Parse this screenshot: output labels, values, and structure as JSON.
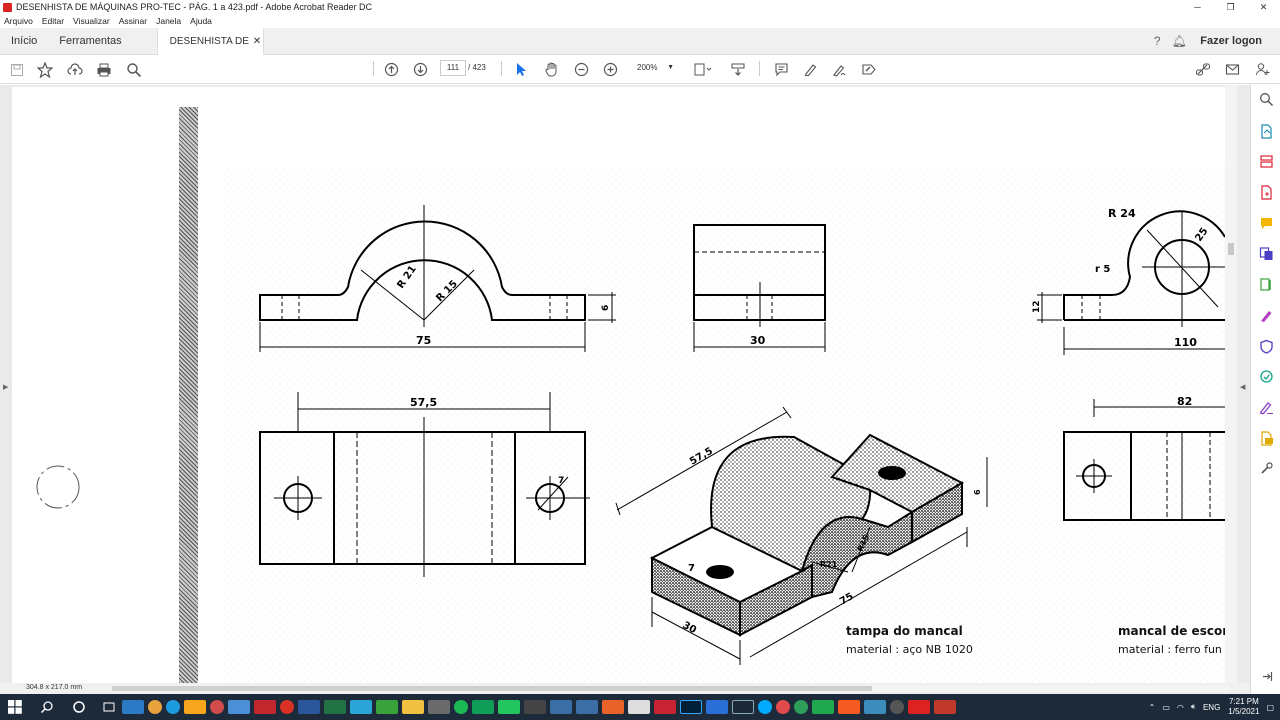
{
  "window": {
    "title": "DESENHISTA DE MÁQUINAS PRO-TEC - PÁG. 1 a 423.pdf - Adobe Acrobat Reader DC",
    "minimize": "─",
    "maximize": "❐",
    "close": "✕"
  },
  "menu": [
    "Arquivo",
    "Editar",
    "Visualizar",
    "Assinar",
    "Janela",
    "Ajuda"
  ],
  "tabs": {
    "home": "Início",
    "tools": "Ferramentas",
    "document": "DESENHISTA DE M...",
    "login": "Fazer logon"
  },
  "toolbar": {
    "page_current": "111",
    "page_total": "/ 423",
    "zoom": "200%"
  },
  "status": {
    "page_dims": "304.8 x 217.0 mm"
  },
  "drawing": {
    "dims_front": {
      "r_outer": "R 21",
      "r_inner": "R 15",
      "width": "75",
      "height": "6"
    },
    "dims_side": {
      "width": "30"
    },
    "dims_right": {
      "r24": "R 24",
      "r5": "r 5",
      "d25": "25",
      "h12": "12",
      "w110": "110",
      "w82": "82"
    },
    "dims_top": {
      "span": "57,5",
      "hole": "7"
    },
    "dims_iso": {
      "span": "57,5",
      "length": "75",
      "depth": "30",
      "hole": "7",
      "r21": "R21",
      "r15": "R15",
      "h6": "6"
    },
    "caption_left": {
      "title": "tampa do mancal",
      "material": "material : aço NB 1020"
    },
    "caption_right": {
      "title": "mancal de escor",
      "material": "material : ferro fun"
    }
  },
  "taskbar": {
    "time": "7:21 PM",
    "date": "1/5/2021",
    "lang": "ENG"
  },
  "colors": {
    "taskbar": "#1c2a3a",
    "accent_blue": "#1a73e8",
    "acrobat_red": "#d22"
  }
}
